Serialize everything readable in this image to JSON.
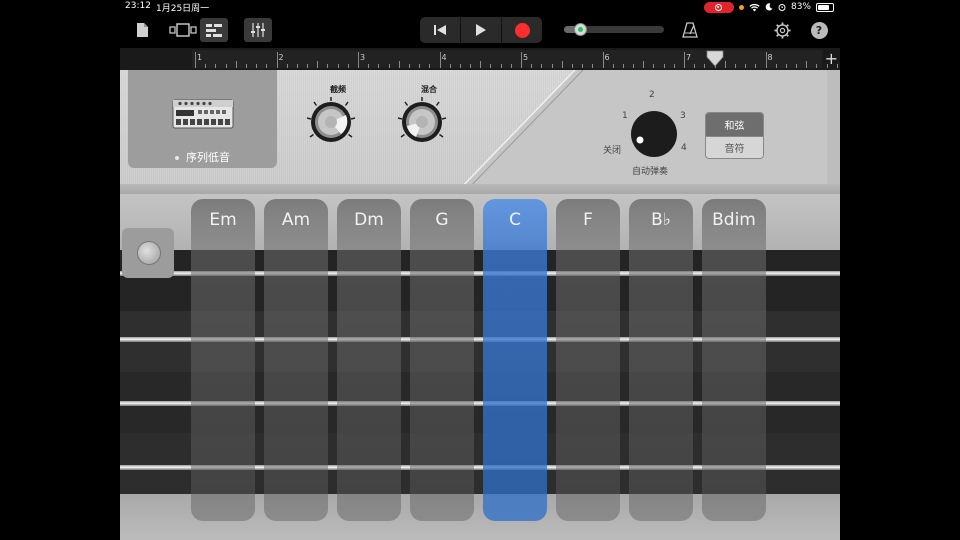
{
  "status": {
    "time": "23:12",
    "date": "1月25日周一",
    "battery": "83%"
  },
  "ruler": {
    "bars": [
      "1",
      "2",
      "3",
      "4",
      "5",
      "6",
      "7",
      "8"
    ]
  },
  "instrument": {
    "preset_name": "序列低音",
    "knob_cutoff_label": "截频",
    "knob_mix_label": "混合",
    "autoplay": {
      "label": "自动弹奏",
      "off_label": "关闭",
      "positions": [
        "1",
        "2",
        "3",
        "4"
      ]
    },
    "mode_toggle": {
      "chords_label": "和弦",
      "notes_label": "音符",
      "selected": "chords"
    }
  },
  "chords": [
    {
      "label": "Em",
      "active": false
    },
    {
      "label": "Am",
      "active": false
    },
    {
      "label": "Dm",
      "active": false
    },
    {
      "label": "G",
      "active": false
    },
    {
      "label": "C",
      "active": true
    },
    {
      "label": "F",
      "active": false
    },
    {
      "label": "B♭",
      "active": false
    },
    {
      "label": "Bdim",
      "active": false
    }
  ],
  "colors": {
    "record": "#ff2d2d",
    "active_chord": "#4a86d6",
    "status_record_pill": "#e0242b"
  }
}
